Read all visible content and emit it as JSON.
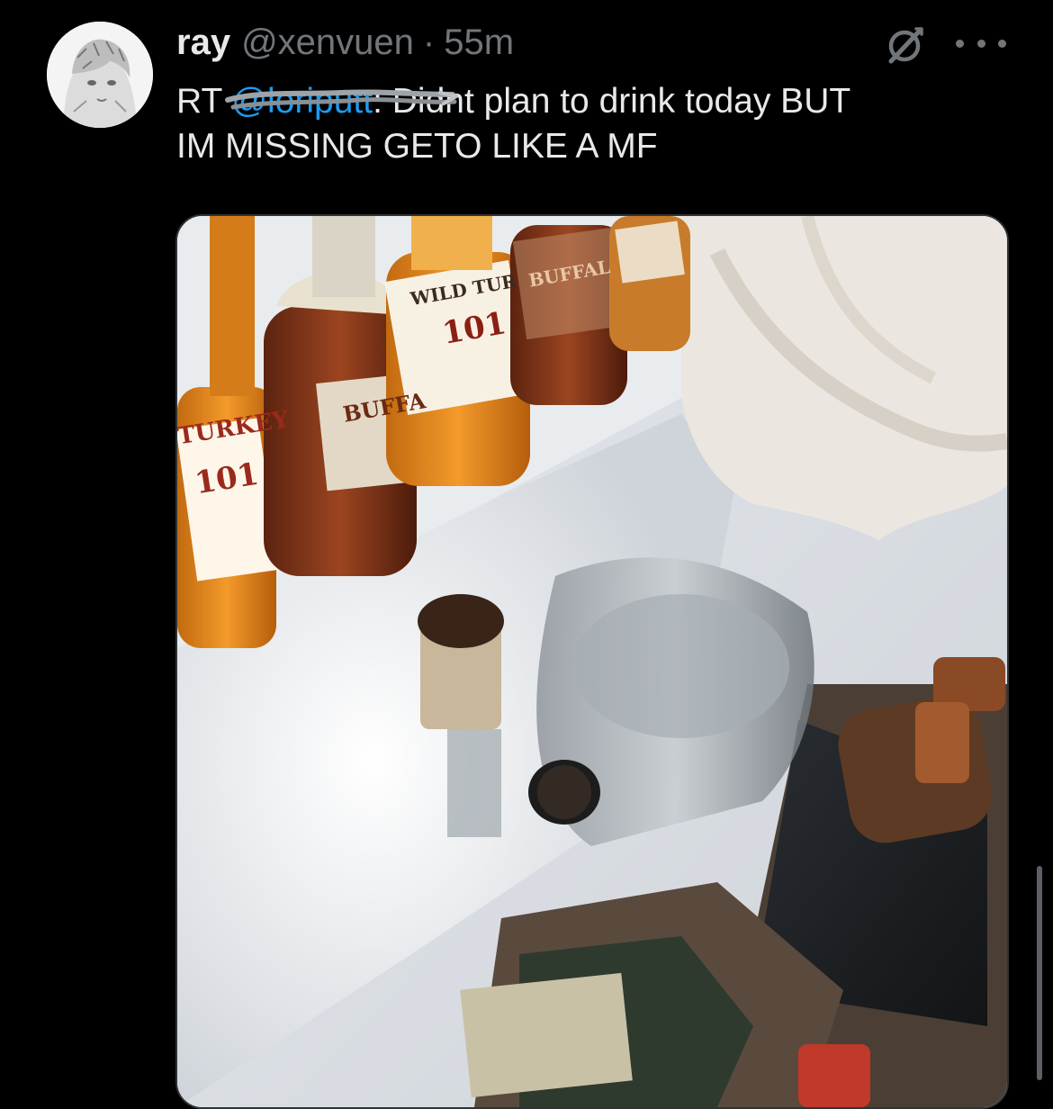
{
  "tweet": {
    "display_name": "ray",
    "handle": "@xenvuen",
    "separator": "·",
    "time": "55m",
    "text_prefix": "RT",
    "mention": "@loriputt",
    "mention_suffix": ":",
    "text_line1": "Didnt plan to drink today BUT",
    "text_line2": "IM MISSING GETO LIKE A MF"
  },
  "icons": {
    "avatar": "anime-avatar",
    "grok": "grok-icon",
    "more": "more-icon"
  },
  "media": {
    "labels": {
      "turkey_1": "TURKEY",
      "turkey_101": "101",
      "buffalo_1": "BUFFA",
      "wild_turkey": "WILD TUR",
      "wild_101": "101",
      "buffalo_2": "BUFFAL"
    }
  },
  "colors": {
    "background": "#000000",
    "text": "#e7e9ea",
    "secondary": "#71767b",
    "link": "#1d9bf0"
  }
}
